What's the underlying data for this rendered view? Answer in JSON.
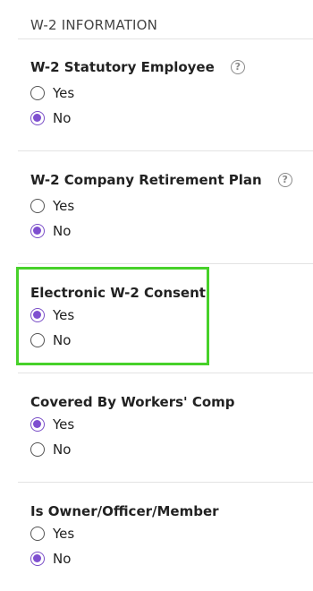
{
  "section": {
    "title": "W-2 INFORMATION"
  },
  "groups": [
    {
      "title": "W-2 Statutory Employee",
      "has_help": true,
      "options": [
        "Yes",
        "No"
      ],
      "selected": "No"
    },
    {
      "title": "W-2 Company Retirement Plan",
      "has_help": true,
      "options": [
        "Yes",
        "No"
      ],
      "selected": "No"
    },
    {
      "title": "Electronic W-2 Consent",
      "has_help": false,
      "highlighted": true,
      "options": [
        "Yes",
        "No"
      ],
      "selected": "Yes"
    },
    {
      "title": "Covered By Workers' Comp",
      "has_help": false,
      "options": [
        "Yes",
        "No"
      ],
      "selected": "Yes"
    },
    {
      "title": "Is Owner/Officer/Member",
      "has_help": false,
      "options": [
        "Yes",
        "No"
      ],
      "selected": "No"
    }
  ],
  "help_icon": {
    "glyph": "?",
    "name": "help-icon"
  },
  "colors": {
    "radio_selected": "#7f4fd0",
    "highlight_border": "#47d12a",
    "divider": "#e3e3e3"
  }
}
